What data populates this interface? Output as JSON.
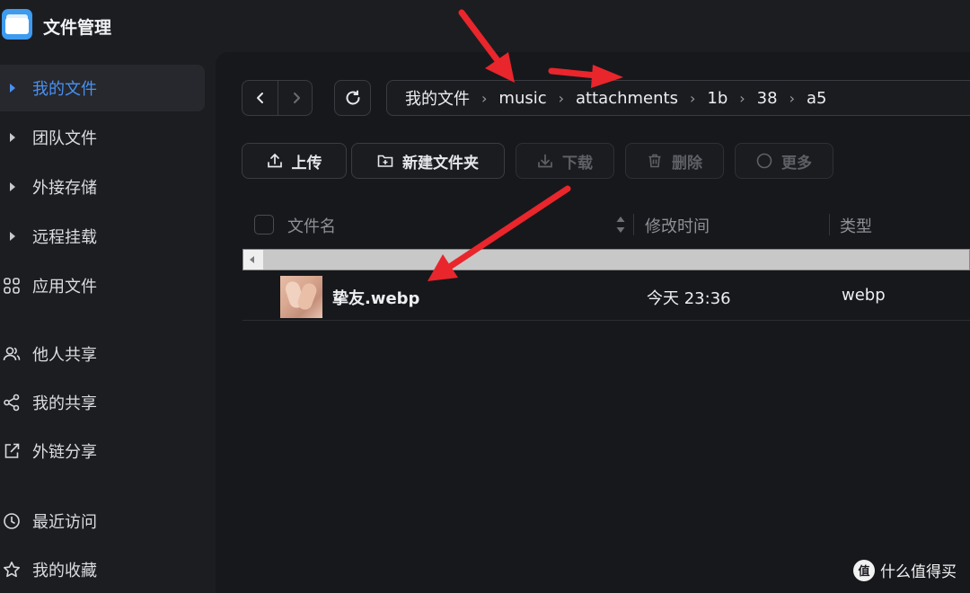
{
  "app": {
    "title": "文件管理",
    "logo_icon": "folder-app-icon"
  },
  "sidebar": {
    "items": [
      {
        "label": "我的文件",
        "icon": "caret-right-icon",
        "active": true
      },
      {
        "label": "团队文件",
        "icon": "caret-right-icon"
      },
      {
        "label": "外接存储",
        "icon": "caret-right-icon"
      },
      {
        "label": "远程挂载",
        "icon": "caret-right-icon"
      },
      {
        "label": "应用文件",
        "icon": "grid-icon"
      },
      {
        "label": "他人共享",
        "icon": "users-icon"
      },
      {
        "label": "我的共享",
        "icon": "share-icon"
      },
      {
        "label": "外链分享",
        "icon": "external-link-icon"
      },
      {
        "label": "最近访问",
        "icon": "clock-icon"
      },
      {
        "label": "我的收藏",
        "icon": "star-icon"
      }
    ]
  },
  "breadcrumb": {
    "items": [
      "我的文件",
      "music",
      "attachments",
      "1b",
      "38",
      "a5"
    ],
    "separator": "›"
  },
  "toolbar": {
    "upload_label": "上传",
    "new_folder_label": "新建文件夹",
    "download_label": "下载",
    "delete_label": "删除",
    "more_label": "更多"
  },
  "table": {
    "headers": {
      "name": "文件名",
      "modified": "修改时间",
      "type": "类型"
    },
    "rows": [
      {
        "name": "挚友.webp",
        "modified": "今天 23:36",
        "type": "webp"
      }
    ]
  },
  "watermark": {
    "logo_text": "值",
    "text": "什么值得买"
  },
  "colors": {
    "accent": "#4a90f0",
    "annotation_arrow": "#e8262c",
    "background": "#1c1d21",
    "panel": "#17181c"
  }
}
